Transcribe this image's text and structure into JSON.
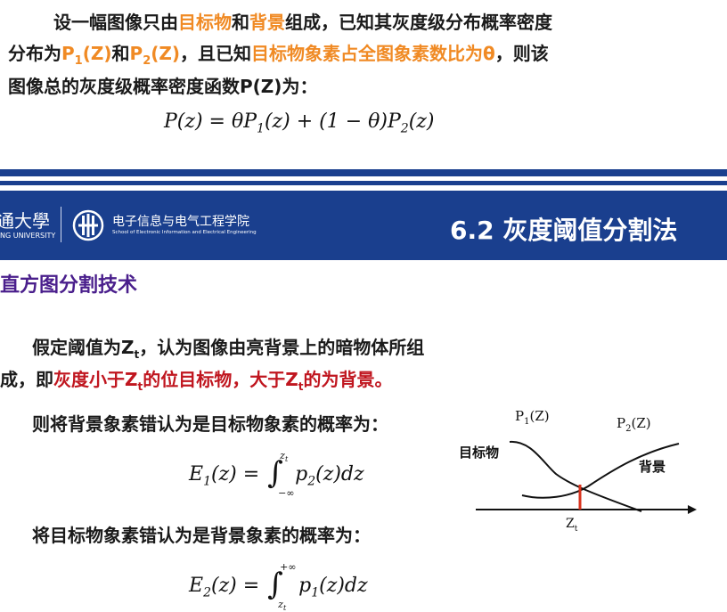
{
  "top": {
    "line1": {
      "p1": "设一幅图像只由",
      "o1": "目标物",
      "p2": "和",
      "o2": "背景",
      "p3": "组成，已知其灰度级分布概率密度"
    },
    "line2": {
      "p1": "分布为",
      "o1": "P1(Z)",
      "p2": "和",
      "o2": "P2(Z)",
      "p3": "，且已知",
      "o3": "目标物象素占全图象素数比为θ",
      "p4": "，则该"
    },
    "line3": "图像总的灰度级概率密度函数P(Z)为：",
    "formula": "P(z) = θP1(z) + (1−θ)P2(z)"
  },
  "header": {
    "university_cn": "通大學",
    "university_en": "NG UNIVERSITY",
    "school_cn": "电子信息与电气工程学院",
    "school_en": "School of Electronic Information and Electrical Engineering",
    "section_title": "6.2 灰度阈值分割法",
    "colors": {
      "bar": "#1a3f8e",
      "accent": "#f08a24",
      "red": "#c0161f",
      "purple": "#4a1f8c"
    }
  },
  "body": {
    "subtitle": "直方图分割技术",
    "para1": {
      "p1": "假定阈值为Z",
      "sub": "t",
      "p2": "，认为图像由亮背景上的暗物体所组"
    },
    "para2": {
      "p1": "成，即",
      "r1": "灰度小于Z",
      "rsub1": "t",
      "r2": "的位目标物，大于Z",
      "rsub2": "t",
      "r3": "的为背景。"
    },
    "para3": "则将背景象素错认为是目标物象素的概率为：",
    "formula1": "E1(z) = ∫ p2(z)dz (−∞ to zt)",
    "para4": "将目标物象素错认为是背景象素的概率为：",
    "formula2": "E2(z) = ∫ p1(z)dz (zt to +∞)"
  },
  "diagram": {
    "label_p1": "P1(Z)",
    "label_p2": "P2(Z)",
    "label_object": "目标物",
    "label_background": "背景",
    "label_threshold": "Zt"
  }
}
